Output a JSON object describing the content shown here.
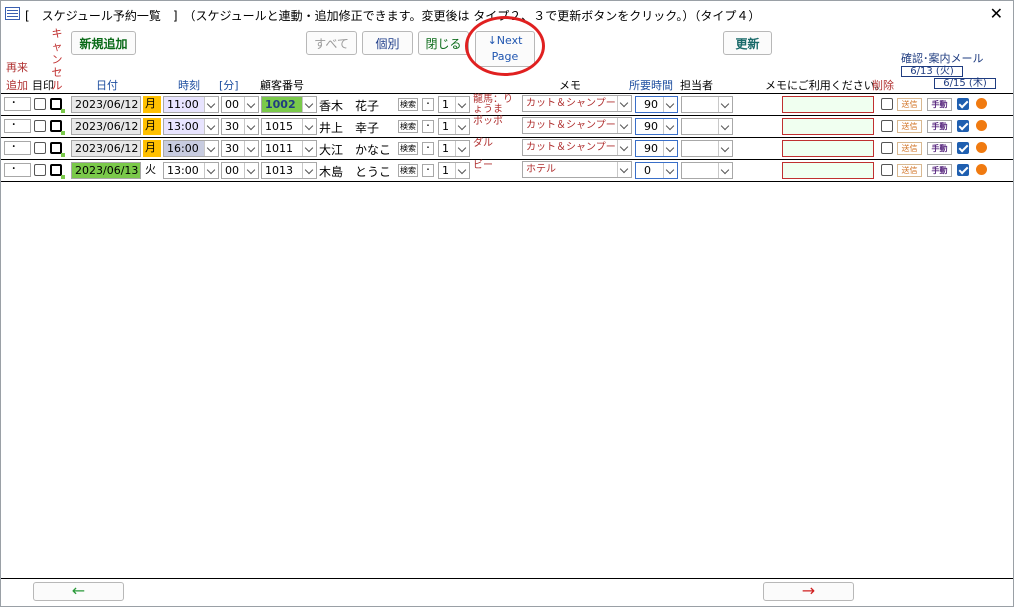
{
  "window": {
    "title": "[　スケジュール予約一覧　]　（スケジュールと連動・追加修正できます。変更後は タイプ２、３で更新ボタンをクリック。）（タイプ４）",
    "close_label": "✕"
  },
  "toolbar": {
    "new_label": "新規追加",
    "all_label": "すべて",
    "individual_label": "個別",
    "close_label": "閉じる",
    "next_line1": "↓Next",
    "next_line2": "Page",
    "update_label": "更新"
  },
  "headers": {
    "revisit": "再来",
    "add": "追加",
    "mark": "目印",
    "cancel": "キャンセル",
    "date": "日付",
    "time": "時刻",
    "minute": "[分]",
    "customer": "顧客番号",
    "memo": "メモ",
    "duration": "所要時間",
    "staff": "担当者",
    "memo_use": "メモにご利用ください。",
    "delete": "削除",
    "confirm_mail": "確認･案内メール",
    "date_a": "6/13 (火)",
    "date_b": "6/15 (木)"
  },
  "rows": [
    {
      "dot": "･",
      "date": "2023/06/12",
      "day": "月",
      "hour": "11:00",
      "min": "00",
      "customer_no": "1002",
      "name": "香木　花子",
      "search": "検索",
      "small_dot": "･",
      "count": "1",
      "pet": "龍馬：りょうま",
      "memo": "カット＆シャンプー",
      "duration": "90",
      "staff": "",
      "memo_input": "",
      "send": "送信",
      "manual": "手動",
      "mail_checked": true
    },
    {
      "dot": "･",
      "date": "2023/06/12",
      "day": "月",
      "hour": "13:00",
      "min": "30",
      "customer_no": "1015",
      "name": "井上　幸子",
      "search": "検索",
      "small_dot": "･",
      "count": "1",
      "pet": "ポッポ",
      "memo": "カット＆シャンプー",
      "duration": "90",
      "staff": "",
      "memo_input": "",
      "send": "送信",
      "manual": "手動",
      "mail_checked": true
    },
    {
      "dot": "･",
      "date": "2023/06/12",
      "day": "月",
      "hour": "16:00",
      "min": "30",
      "customer_no": "1011",
      "name": "大江　かなこ",
      "search": "検索",
      "small_dot": "･",
      "count": "1",
      "pet": "ダル",
      "memo": "カット＆シャンプー",
      "duration": "90",
      "staff": "",
      "memo_input": "",
      "send": "送信",
      "manual": "手動",
      "mail_checked": true
    },
    {
      "dot": "･",
      "date": "2023/06/13",
      "day": "火",
      "hour": "13:00",
      "min": "00",
      "customer_no": "1013",
      "name": "木島　とうこ",
      "search": "検索",
      "small_dot": "･",
      "count": "1",
      "pet": "ビー",
      "memo": "ホテル",
      "duration": "0",
      "staff": "",
      "memo_input": "",
      "send": "送信",
      "manual": "手動",
      "mail_checked": true
    }
  ],
  "footer": {
    "prev_label": "←",
    "next_label": "→"
  },
  "colors": {
    "accent_red": "#e02020",
    "weekday_yellow": "#ffc000",
    "highlight_green": "#7ac94a",
    "status_orange": "#f07a10"
  }
}
